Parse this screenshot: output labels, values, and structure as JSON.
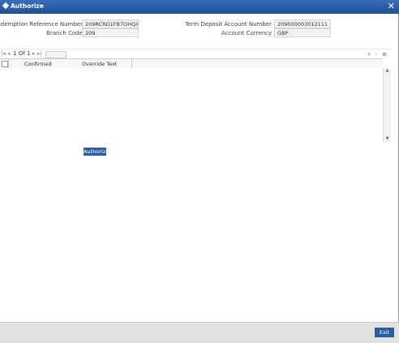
{
  "window": {
    "title": "Authorize",
    "close_glyph": "✕"
  },
  "form": {
    "redemption_ref_label": "Redemption Reference Number",
    "redemption_ref_value": "209RCRD1FB7OHQX",
    "branch_code_label": "Branch Code",
    "branch_code_value": "209",
    "td_account_label": "Term Deposit Account Number",
    "td_account_value": "209000003012111",
    "currency_label": "Account Currency",
    "currency_value": "GBP"
  },
  "pager": {
    "first": "|◂",
    "prev": "◂",
    "info": "1 Of 1",
    "next": "▸",
    "last": "▸|"
  },
  "toolbar": {
    "add": "+",
    "remove": "-",
    "settings": "≡"
  },
  "grid": {
    "columns": [
      "Confirmed",
      "Override Text"
    ],
    "rows": []
  },
  "actions": {
    "authorize_label": "Authorize",
    "exit_label": "Exit"
  },
  "colors": {
    "accent": "#2e5d9f",
    "titlebar": "#1f4f97"
  }
}
